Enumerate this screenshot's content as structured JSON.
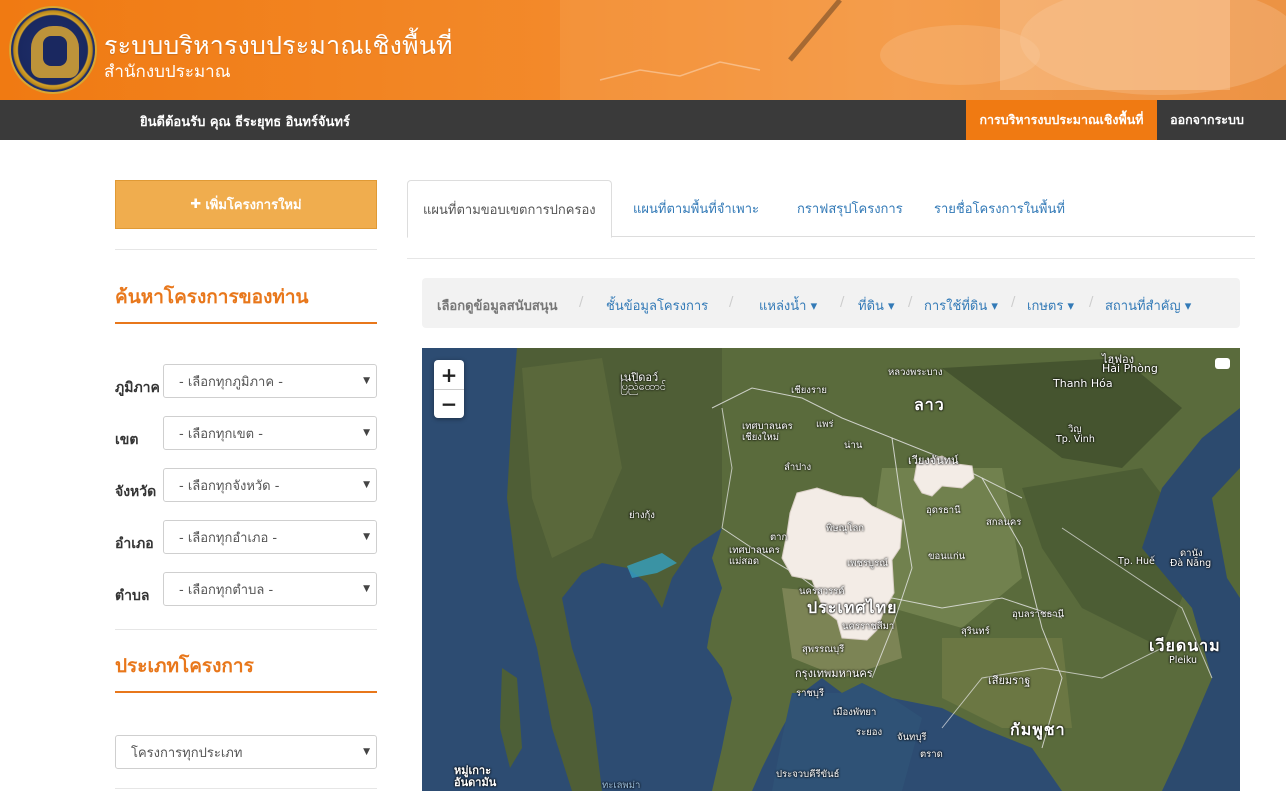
{
  "header": {
    "title": "ระบบบริหารงบประมาณเชิงพื้นที่",
    "subtitle": "สำนักงบประมาณ"
  },
  "navbar": {
    "welcome": "ยินดีต้อนรับ คุณ ธีระยุทธ อินทร์จันทร์",
    "active_item": "การบริหารงบประมาณเชิงพื้นที่",
    "logout": "ออกจากระบบ"
  },
  "sidebar": {
    "add_button": "เพิ่มโครงการใหม่",
    "search_heading": "ค้นหาโครงการของท่าน",
    "filters": [
      {
        "label": "ภูมิภาค",
        "value": "- เลือกทุกภูมิภาค -"
      },
      {
        "label": "เขต",
        "value": "- เลือกทุกเขต -"
      },
      {
        "label": "จังหวัด",
        "value": "- เลือกทุกจังหวัด -"
      },
      {
        "label": "อำเภอ",
        "value": "- เลือกทุกอำเภอ -"
      },
      {
        "label": "ตำบล",
        "value": "- เลือกทุกตำบล -"
      }
    ],
    "type_heading": "ประเภทโครงการ",
    "type_select": "โครงการทุกประเภท"
  },
  "tabs": [
    {
      "label": "แผนที่ตามขอบเขตการปกครอง",
      "active": true
    },
    {
      "label": "แผนที่ตามพื้นที่จำเพาะ",
      "active": false
    },
    {
      "label": "กราฟสรุปโครงการ",
      "active": false
    },
    {
      "label": "รายชื่อโครงการในพื้นที่",
      "active": false
    }
  ],
  "layerbar": {
    "label": "เลือกดูข้อมูลสนับสนุน",
    "items": [
      {
        "label": "ชั้นข้อมูลโครงการ",
        "dropdown": false
      },
      {
        "label": "แหล่งน้ำ",
        "dropdown": true
      },
      {
        "label": "ที่ดิน",
        "dropdown": true
      },
      {
        "label": "การใช้ที่ดิน",
        "dropdown": true
      },
      {
        "label": "เกษตร",
        "dropdown": true
      },
      {
        "label": "สถานที่สำคัญ",
        "dropdown": true
      }
    ]
  },
  "map": {
    "zoom_in": "+",
    "zoom_out": "−",
    "labels": {
      "laos": "ลาว",
      "thailand": "ประเทศไทย",
      "cambodia": "กัมพูชา",
      "vietnam": "เวียดนาม",
      "myanmar_my": "ပြည်ထောင်",
      "naypyidaw": "เนปิดอว์",
      "chiangrai": "เชียงราย",
      "chiangmai": "เทศบาลนคร เชียงใหม่",
      "phrae": "แพร่",
      "nan": "น่าน",
      "lampang": "ลำปาง",
      "tak": "ตาก",
      "maesot": "เทศบาลนคร แม่สอด",
      "phitsanulok": "พิษณุโลก",
      "phetchabun": "เพชรบูรณ์",
      "nakhonsawan": "นครสวรรค์",
      "khonkaen": "ขอนแก่น",
      "udonthani": "อุดรธานี",
      "sakon": "สกลนคร",
      "vientiane": "เวียงจันทน์",
      "luangprabang": "หลวงพระบาง",
      "haiphong": "Hải Phòng",
      "haiphong_th": "ไฮฟอง",
      "thanhhoa": "Thanh Hóa",
      "vinh": "Tp. Vinh",
      "vinh_th": "วิญ",
      "hue": "Tp. Huế",
      "danang": "Đà Nẵng",
      "danang_th": "ดานัง",
      "yangon": "ย่างกุ้ง",
      "korat": "นครราชสีมา",
      "surin": "สุรินทร์",
      "ubon": "อุบลราชธานี",
      "suphan": "สุพรรณบุรี",
      "bangkok": "กรุงเทพมหานคร",
      "ratchaburi": "ราชบุรี",
      "pattaya": "เมืองพัทยา",
      "rayong": "ระยอง",
      "chanthaburi": "จันทบุรี",
      "trat": "ตราด",
      "siemreap": "เสียมราฐ",
      "pleiku": "Pleiku",
      "prachuap": "ประจวบคีรีขันธ์",
      "andaman": "หมู่เกาะ อันดามัน",
      "sea": "ทะเลพม่า"
    }
  }
}
